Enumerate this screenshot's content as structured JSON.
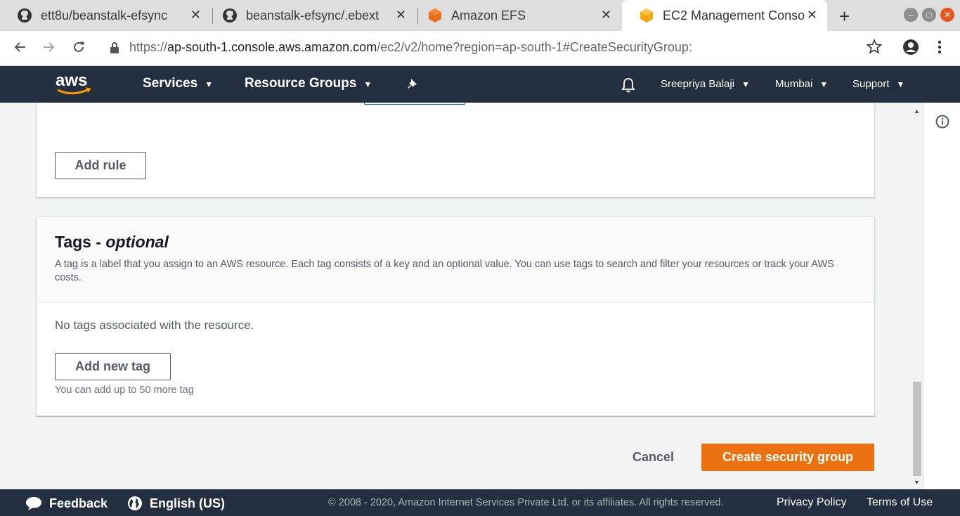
{
  "browser": {
    "tabs": [
      {
        "label": "ett8u/beanstalk-efsync",
        "icon": "github-icon",
        "active": false
      },
      {
        "label": "beanstalk-efsync/.ebext",
        "icon": "github-icon",
        "active": false
      },
      {
        "label": "Amazon EFS",
        "icon": "aws-efs-icon",
        "active": false
      },
      {
        "label": "EC2 Management Conso",
        "icon": "aws-ec2-icon",
        "active": true
      }
    ],
    "close_glyph": "✕",
    "new_tab_glyph": "+",
    "url_scheme": "https://",
    "url_host": "ap-south-1.console.aws.amazon.com",
    "url_path": "/ec2/v2/home?region=ap-south-1#CreateSecurityGroup:"
  },
  "aws_header": {
    "logo_text": "aws",
    "services": "Services",
    "resource_groups": "Resource Groups",
    "user": "Sreepriya Balaji",
    "region": "Mumbai",
    "support": "Support"
  },
  "inbound_rules": {
    "add_rule_label": "Add rule"
  },
  "tags": {
    "title": "Tags - ",
    "title_optional": "optional",
    "description": "A tag is a label that you assign to an AWS resource. Each tag consists of a key and an optional value. You can use tags to search and filter your resources or track your AWS costs.",
    "empty_message": "No tags associated with the resource.",
    "add_tag_label": "Add new tag",
    "limit_hint": "You can add up to 50 more tag"
  },
  "actions": {
    "cancel_label": "Cancel",
    "create_label": "Create security group"
  },
  "footer": {
    "feedback": "Feedback",
    "language": "English (US)",
    "copyright": "© 2008 - 2020, Amazon Internet Services Private Ltd. or its affiliates. All rights reserved.",
    "privacy": "Privacy Policy",
    "terms": "Terms of Use"
  },
  "colors": {
    "aws_nav": "#232f3e",
    "primary_button": "#ec7211",
    "focus_border": "#0073bb"
  }
}
